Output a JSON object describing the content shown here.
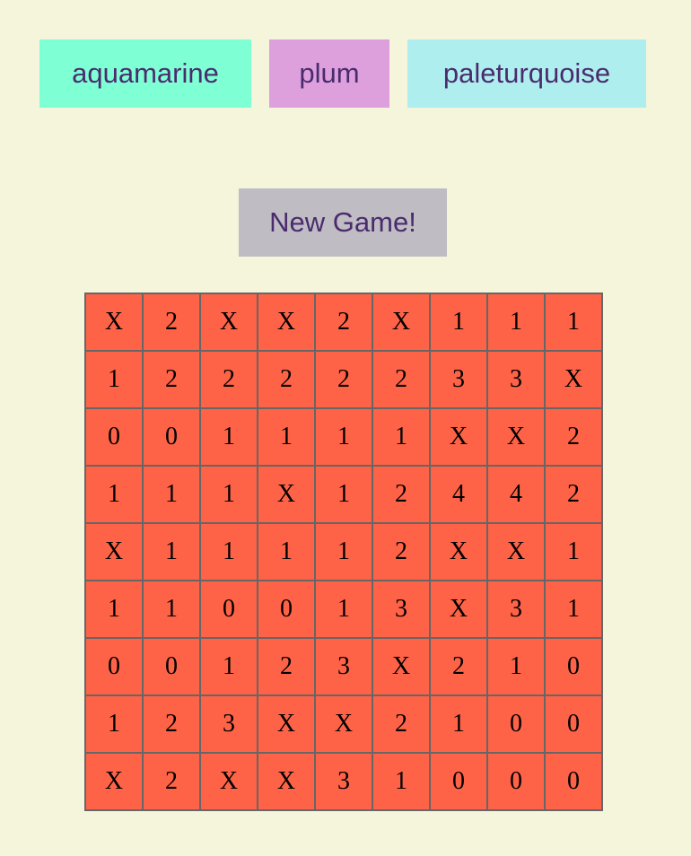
{
  "theme_buttons": [
    {
      "label": "aquamarine",
      "color": "#7fffd4"
    },
    {
      "label": "plum",
      "color": "#dda0dd"
    },
    {
      "label": "paleturquoise",
      "color": "#afeeee"
    }
  ],
  "new_game": {
    "label": "New Game!",
    "color": "#c0bcc4"
  },
  "board": {
    "cell_color": "#ff6347",
    "border_color": "#666666",
    "rows": [
      [
        "X",
        "2",
        "X",
        "X",
        "2",
        "X",
        "1",
        "1",
        "1"
      ],
      [
        "1",
        "2",
        "2",
        "2",
        "2",
        "2",
        "3",
        "3",
        "X"
      ],
      [
        "0",
        "0",
        "1",
        "1",
        "1",
        "1",
        "X",
        "X",
        "2"
      ],
      [
        "1",
        "1",
        "1",
        "X",
        "1",
        "2",
        "4",
        "4",
        "2"
      ],
      [
        "X",
        "1",
        "1",
        "1",
        "1",
        "2",
        "X",
        "X",
        "1"
      ],
      [
        "1",
        "1",
        "0",
        "0",
        "1",
        "3",
        "X",
        "3",
        "1"
      ],
      [
        "0",
        "0",
        "1",
        "2",
        "3",
        "X",
        "2",
        "1",
        "0"
      ],
      [
        "1",
        "2",
        "3",
        "X",
        "X",
        "2",
        "1",
        "0",
        "0"
      ],
      [
        "X",
        "2",
        "X",
        "X",
        "3",
        "1",
        "0",
        "0",
        "0"
      ]
    ]
  }
}
